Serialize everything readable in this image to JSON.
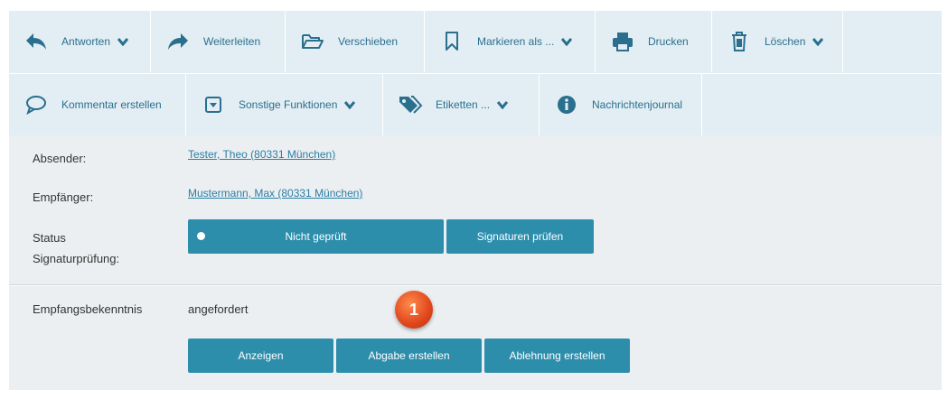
{
  "toolbar": {
    "row1": [
      {
        "label": "Antworten",
        "icon": "reply-icon",
        "dropdown": true
      },
      {
        "label": "Weiterleiten",
        "icon": "forward-icon",
        "dropdown": false
      },
      {
        "label": "Verschieben",
        "icon": "folder-open-icon",
        "dropdown": false
      },
      {
        "label": "Markieren als ...",
        "icon": "bookmark-icon",
        "dropdown": true
      },
      {
        "label": "Drucken",
        "icon": "printer-icon",
        "dropdown": false
      },
      {
        "label": "Löschen",
        "icon": "trash-icon",
        "dropdown": true
      }
    ],
    "row2": [
      {
        "label": "Kommentar erstellen",
        "icon": "comment-icon",
        "dropdown": false
      },
      {
        "label": "Sonstige Funktionen",
        "icon": "dropdown-box-icon",
        "dropdown": true
      },
      {
        "label": "Etiketten ...",
        "icon": "tags-icon",
        "dropdown": true
      },
      {
        "label": "Nachrichtenjournal",
        "icon": "info-icon",
        "dropdown": false
      }
    ]
  },
  "details": {
    "sender_label": "Absender:",
    "sender_value": "Tester, Theo (80331 München)",
    "recipient_label": "Empfänger:",
    "recipient_value": "Mustermann, Max (80331 München)",
    "status_label_line1": "Status",
    "status_label_line2": "Signaturprüfung:",
    "status_button": "Nicht geprüft",
    "verify_button": "Signaturen prüfen"
  },
  "receipt": {
    "label": "Empfangsbekenntnis",
    "value": "angefordert",
    "buttons": [
      "Anzeigen",
      "Abgabe erstellen",
      "Ablehnung erstellen"
    ]
  },
  "callout": {
    "number": "1"
  },
  "colors": {
    "accent": "#2d8eac",
    "toolbar_bg": "#e3eef4",
    "panel_bg": "#eceff1",
    "icon": "#2a6f8e",
    "link": "#2a7fa4",
    "marker": "#e0461c"
  }
}
